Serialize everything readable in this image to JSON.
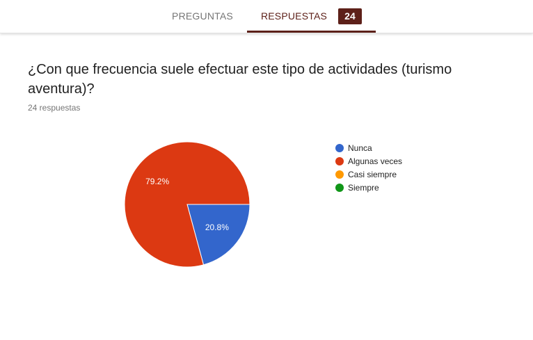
{
  "tabs": {
    "preguntas": "PREGUNTAS",
    "respuestas": "RESPUESTAS",
    "respuestas_count": "24"
  },
  "question": {
    "title": "¿Con que frecuencia suele efectuar este tipo de actividades (turismo aventura)?",
    "response_count": "24 respuestas"
  },
  "colors": {
    "accent": "#5d2019"
  },
  "chart_data": {
    "type": "pie",
    "categories": [
      "Nunca",
      "Algunas veces",
      "Casi siempre",
      "Siempre"
    ],
    "values": [
      20.8,
      79.2,
      0,
      0
    ],
    "labels": [
      "20.8%",
      "79.2%",
      "",
      ""
    ],
    "colors": [
      "#3366cc",
      "#dc3912",
      "#ff9900",
      "#109618"
    ],
    "legend_position": "right"
  }
}
